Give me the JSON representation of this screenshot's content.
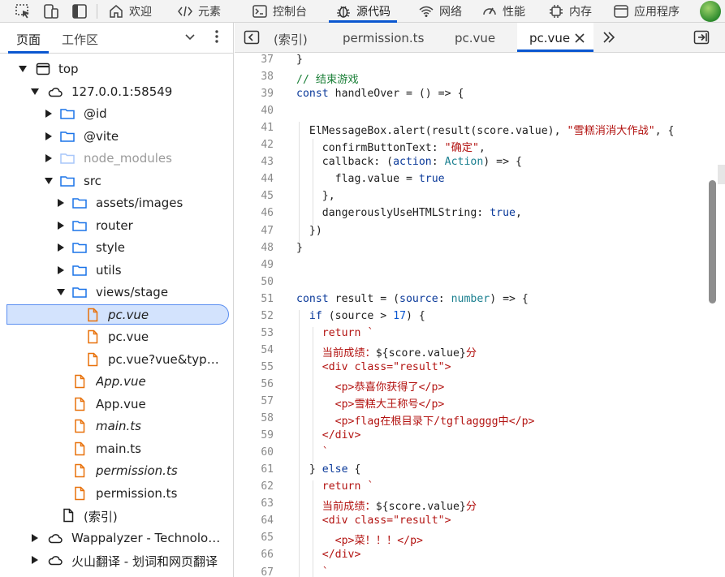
{
  "toolbar": {
    "tabs": [
      {
        "label": "欢迎",
        "icon": "home-icon"
      },
      {
        "label": "元素",
        "icon": "code-tags-icon"
      },
      {
        "label": "控制台",
        "icon": "console-icon"
      },
      {
        "label": "源代码",
        "icon": "bug-icon",
        "active": true
      },
      {
        "label": "网络",
        "icon": "wifi-icon"
      },
      {
        "label": "性能",
        "icon": "gauge-icon"
      },
      {
        "label": "内存",
        "icon": "chip-icon"
      },
      {
        "label": "应用程序",
        "icon": "app-window-icon"
      }
    ],
    "accent": "#0b57d0"
  },
  "left_panel": {
    "tabs": [
      "页面",
      "工作区"
    ],
    "tree": [
      {
        "label": "top",
        "type": "frame",
        "depth": 0,
        "expanded": true
      },
      {
        "label": "127.0.0.1:58549",
        "type": "cloud",
        "depth": 1,
        "expanded": true
      },
      {
        "label": "@id",
        "type": "folder",
        "depth": 2
      },
      {
        "label": "@vite",
        "type": "folder",
        "depth": 2
      },
      {
        "label": "node_modules",
        "type": "folder",
        "depth": 2,
        "dim": true
      },
      {
        "label": "src",
        "type": "folder",
        "depth": 2,
        "expanded": true
      },
      {
        "label": "assets/images",
        "type": "folder",
        "depth": 3
      },
      {
        "label": "router",
        "type": "folder",
        "depth": 3
      },
      {
        "label": "style",
        "type": "folder",
        "depth": 3
      },
      {
        "label": "utils",
        "type": "folder",
        "depth": 3
      },
      {
        "label": "views/stage",
        "type": "folder",
        "depth": 3,
        "expanded": true
      },
      {
        "label": "pc.vue",
        "type": "file",
        "depth": 4,
        "italic": true,
        "selected": true
      },
      {
        "label": "pc.vue",
        "type": "file",
        "depth": 4
      },
      {
        "label": "pc.vue?vue&type…",
        "type": "file",
        "depth": 4
      },
      {
        "label": "App.vue",
        "type": "file",
        "depth": 3,
        "italic": true
      },
      {
        "label": "App.vue",
        "type": "file",
        "depth": 3
      },
      {
        "label": "main.ts",
        "type": "file",
        "depth": 3,
        "italic": true
      },
      {
        "label": "main.ts",
        "type": "file",
        "depth": 3
      },
      {
        "label": "permission.ts",
        "type": "file",
        "depth": 3,
        "italic": true
      },
      {
        "label": "permission.ts",
        "type": "file",
        "depth": 3
      },
      {
        "label": "(索引)",
        "type": "doc",
        "depth": 2
      },
      {
        "label": "Wappalyzer - Technolog…",
        "type": "cloud",
        "depth": 1,
        "collapsed": true
      },
      {
        "label": "火山翻译 - 划词和网页翻译",
        "type": "cloud",
        "depth": 1,
        "collapsed": true
      }
    ]
  },
  "editor": {
    "tabs": [
      "(索引)",
      "permission.ts",
      "pc.vue",
      "pc.vue"
    ],
    "active_tab": 3,
    "line_numbers": [
      "37",
      "38",
      "39",
      "40",
      "41",
      "42",
      "43",
      "44",
      "45",
      "46",
      "47",
      "48",
      "49",
      "50",
      "51",
      "52",
      "53",
      "54",
      "55",
      "56",
      "57",
      "58",
      "59",
      "60",
      "61",
      "62",
      "63",
      "64",
      "65",
      "66",
      "67"
    ],
    "code": [
      [
        [
          "f",
          "}"
        ]
      ],
      [
        [
          "c",
          "// 结束游戏"
        ]
      ],
      [
        [
          "k",
          "const "
        ],
        [
          "f",
          "handleOver = () => {"
        ]
      ],
      [],
      [
        [
          "f",
          "  ElMessageBox.alert(result(score.value), "
        ],
        [
          "s",
          "\"雪糕消消大作战\""
        ],
        [
          "f",
          ", {"
        ]
      ],
      [
        [
          "f",
          "    confirmButtonText: "
        ],
        [
          "s",
          "\"确定\""
        ],
        [
          "f",
          ","
        ]
      ],
      [
        [
          "f",
          "    callback: ("
        ],
        [
          "k",
          "action"
        ],
        [
          "f",
          ": "
        ],
        [
          "t",
          "Action"
        ],
        [
          "f",
          ") => {"
        ]
      ],
      [
        [
          "f",
          "      flag.value = "
        ],
        [
          "k",
          "true"
        ]
      ],
      [
        [
          "f",
          "    },"
        ]
      ],
      [
        [
          "f",
          "    dangerouslyUseHTMLString: "
        ],
        [
          "k",
          "true"
        ],
        [
          "f",
          ","
        ]
      ],
      [
        [
          "f",
          "  })"
        ]
      ],
      [
        [
          "f",
          "}"
        ]
      ],
      [],
      [],
      [
        [
          "k",
          "const "
        ],
        [
          "f",
          "result = ("
        ],
        [
          "k",
          "source"
        ],
        [
          "f",
          ": "
        ],
        [
          "t",
          "number"
        ],
        [
          "f",
          ") => {"
        ]
      ],
      [
        [
          "f",
          "  "
        ],
        [
          "k",
          "if"
        ],
        [
          "f",
          " (source > "
        ],
        [
          "n",
          "17"
        ],
        [
          "f",
          ") {"
        ]
      ],
      [
        [
          "f",
          "    "
        ],
        [
          "s",
          "return `"
        ]
      ],
      [
        [
          "s",
          "    当前成绩："
        ],
        [
          "f",
          "${score.value}"
        ],
        [
          "s",
          "分"
        ]
      ],
      [
        [
          "s",
          "    <div class=\"result\">"
        ]
      ],
      [
        [
          "s",
          "      <p>恭喜你获得了</p>"
        ]
      ],
      [
        [
          "s",
          "      <p>雪糕大王称号</p>"
        ]
      ],
      [
        [
          "s",
          "      <p>flag在根目录下/tgflagggg中</p>"
        ]
      ],
      [
        [
          "s",
          "    </div>"
        ]
      ],
      [
        [
          "s",
          "    `"
        ]
      ],
      [
        [
          "f",
          "  } "
        ],
        [
          "k",
          "else"
        ],
        [
          "f",
          " {"
        ]
      ],
      [
        [
          "f",
          "    "
        ],
        [
          "s",
          "return `"
        ]
      ],
      [
        [
          "s",
          "    当前成绩："
        ],
        [
          "f",
          "${score.value}"
        ],
        [
          "s",
          "分"
        ]
      ],
      [
        [
          "s",
          "    <div class=\"result\">"
        ]
      ],
      [
        [
          "s",
          "      <p>菜！！！</p>"
        ]
      ],
      [
        [
          "s",
          "    </div>"
        ]
      ],
      [
        [
          "s",
          "    `"
        ]
      ]
    ]
  }
}
